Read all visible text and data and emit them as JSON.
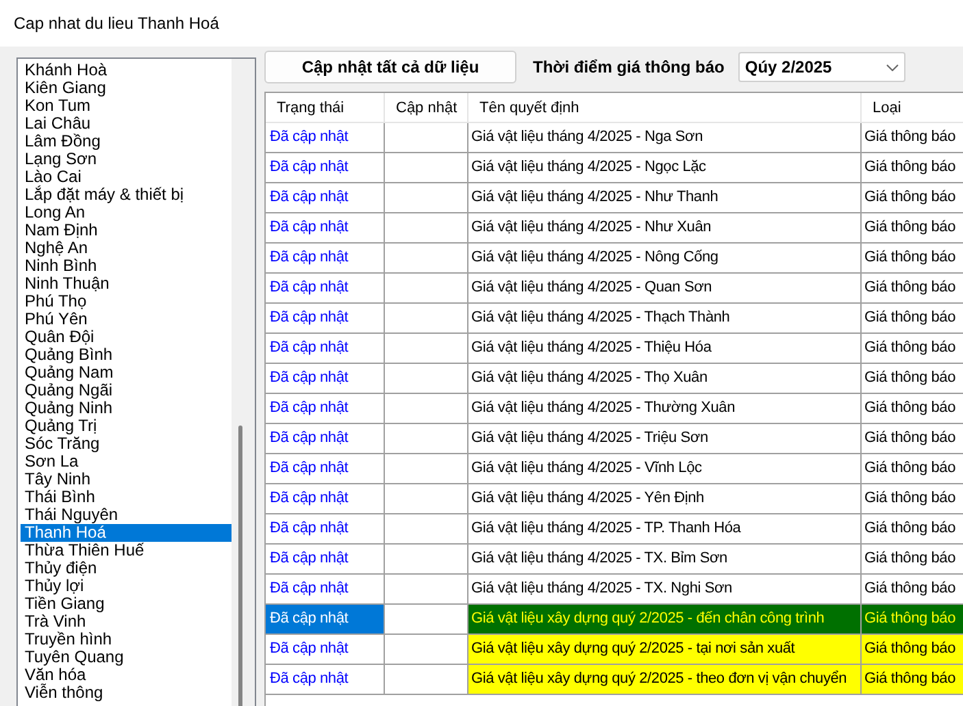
{
  "window": {
    "title": "Cap nhat du lieu Thanh Hoá"
  },
  "provinces": [
    {
      "label": "Khánh Hoà",
      "selected": false
    },
    {
      "label": "Kiên Giang",
      "selected": false
    },
    {
      "label": "Kon Tum",
      "selected": false
    },
    {
      "label": "Lai Châu",
      "selected": false
    },
    {
      "label": "Lâm Đồng",
      "selected": false
    },
    {
      "label": "Lạng Sơn",
      "selected": false
    },
    {
      "label": "Lào Cai",
      "selected": false
    },
    {
      "label": "Lắp đặt máy & thiết bị",
      "selected": false
    },
    {
      "label": "Long An",
      "selected": false
    },
    {
      "label": "Nam Định",
      "selected": false
    },
    {
      "label": "Nghệ An",
      "selected": false
    },
    {
      "label": "Ninh Bình",
      "selected": false
    },
    {
      "label": "Ninh Thuận",
      "selected": false
    },
    {
      "label": "Phú Thọ",
      "selected": false
    },
    {
      "label": "Phú Yên",
      "selected": false
    },
    {
      "label": "Quân Đội",
      "selected": false
    },
    {
      "label": "Quảng Bình",
      "selected": false
    },
    {
      "label": "Quảng Nam",
      "selected": false
    },
    {
      "label": "Quảng Ngãi",
      "selected": false
    },
    {
      "label": "Quảng Ninh",
      "selected": false
    },
    {
      "label": "Quảng Trị",
      "selected": false
    },
    {
      "label": "Sóc Trăng",
      "selected": false
    },
    {
      "label": "Sơn La",
      "selected": false
    },
    {
      "label": "Tây Ninh",
      "selected": false
    },
    {
      "label": "Thái Bình",
      "selected": false
    },
    {
      "label": "Thái Nguyên",
      "selected": false
    },
    {
      "label": "Thanh Hoá",
      "selected": true
    },
    {
      "label": "Thừa Thiên Huế",
      "selected": false
    },
    {
      "label": "Thủy điện",
      "selected": false
    },
    {
      "label": "Thủy lợi",
      "selected": false
    },
    {
      "label": "Tiền Giang",
      "selected": false
    },
    {
      "label": "Trà Vinh",
      "selected": false
    },
    {
      "label": "Truyền hình",
      "selected": false
    },
    {
      "label": "Tuyên Quang",
      "selected": false
    },
    {
      "label": "Văn hóa",
      "selected": false
    },
    {
      "label": "Viễn thông",
      "selected": false
    }
  ],
  "update_all_button": "Cập nhật tất cả dữ liệu",
  "period": {
    "label": "Thời điểm giá thông báo",
    "value": "Qúy 2/2025"
  },
  "table": {
    "columns": [
      "Trạng thái",
      "Cập nhật",
      "Tên quyết định",
      "Loại"
    ],
    "rows": [
      {
        "status": "Đã cập nhật",
        "name": "Giá vật liệu tháng 4/2025 - Nga Sơn",
        "type": "Giá thông báo",
        "highlighted": false,
        "selected": false
      },
      {
        "status": "Đã cập nhật",
        "name": "Giá vật liệu tháng 4/2025 - Ngọc Lặc",
        "type": "Giá thông báo",
        "highlighted": false,
        "selected": false
      },
      {
        "status": "Đã cập nhật",
        "name": "Giá vật liệu tháng 4/2025 - Như Thanh",
        "type": "Giá thông báo",
        "highlighted": false,
        "selected": false
      },
      {
        "status": "Đã cập nhật",
        "name": "Giá vật liệu tháng 4/2025 - Như Xuân",
        "type": "Giá thông báo",
        "highlighted": false,
        "selected": false
      },
      {
        "status": "Đã cập nhật",
        "name": "Giá vật liệu tháng 4/2025 - Nông Cống",
        "type": "Giá thông báo",
        "highlighted": false,
        "selected": false
      },
      {
        "status": "Đã cập nhật",
        "name": "Giá vật liệu tháng 4/2025 - Quan Sơn",
        "type": "Giá thông báo",
        "highlighted": false,
        "selected": false
      },
      {
        "status": "Đã cập nhật",
        "name": "Giá vật liệu tháng 4/2025 - Thạch Thành",
        "type": "Giá thông báo",
        "highlighted": false,
        "selected": false
      },
      {
        "status": "Đã cập nhật",
        "name": "Giá vật liệu tháng 4/2025 - Thiệu Hóa",
        "type": "Giá thông báo",
        "highlighted": false,
        "selected": false
      },
      {
        "status": "Đã cập nhật",
        "name": "Giá vật liệu tháng 4/2025 - Thọ Xuân",
        "type": "Giá thông báo",
        "highlighted": false,
        "selected": false
      },
      {
        "status": "Đã cập nhật",
        "name": "Giá vật liệu tháng 4/2025 - Thường Xuân",
        "type": "Giá thông báo",
        "highlighted": false,
        "selected": false
      },
      {
        "status": "Đã cập nhật",
        "name": "Giá vật liệu tháng 4/2025 - Triệu Sơn",
        "type": "Giá thông báo",
        "highlighted": false,
        "selected": false
      },
      {
        "status": "Đã cập nhật",
        "name": "Giá vật liệu tháng 4/2025 - Vĩnh Lộc",
        "type": "Giá thông báo",
        "highlighted": false,
        "selected": false
      },
      {
        "status": "Đã cập nhật",
        "name": "Giá vật liệu tháng 4/2025 - Yên Định",
        "type": "Giá thông báo",
        "highlighted": false,
        "selected": false
      },
      {
        "status": "Đã cập nhật",
        "name": "Giá vật liệu tháng 4/2025 - TP. Thanh Hóa",
        "type": "Giá thông báo",
        "highlighted": false,
        "selected": false
      },
      {
        "status": "Đã cập nhật",
        "name": "Giá vật liệu tháng 4/2025 - TX. Bỉm Sơn",
        "type": "Giá thông báo",
        "highlighted": false,
        "selected": false
      },
      {
        "status": "Đã cập nhật",
        "name": "Giá vật liệu tháng 4/2025 - TX. Nghi Sơn",
        "type": "Giá thông báo",
        "highlighted": false,
        "selected": false
      },
      {
        "status": "Đã cập nhật",
        "name": "Giá vật liệu xây dựng quý 2/2025 - đến chân công trình",
        "type": "Giá thông báo",
        "highlighted": true,
        "selected": true
      },
      {
        "status": "Đã cập nhật",
        "name": "Giá vật liệu xây dựng quý 2/2025 - tại nơi sản xuất",
        "type": "Giá thông báo",
        "highlighted": true,
        "selected": false
      },
      {
        "status": "Đã cập nhật",
        "name": "Giá vật liệu xây dựng quý 2/2025 - theo đơn vị vận chuyển",
        "type": "Giá thông báo",
        "highlighted": true,
        "selected": false
      }
    ]
  }
}
